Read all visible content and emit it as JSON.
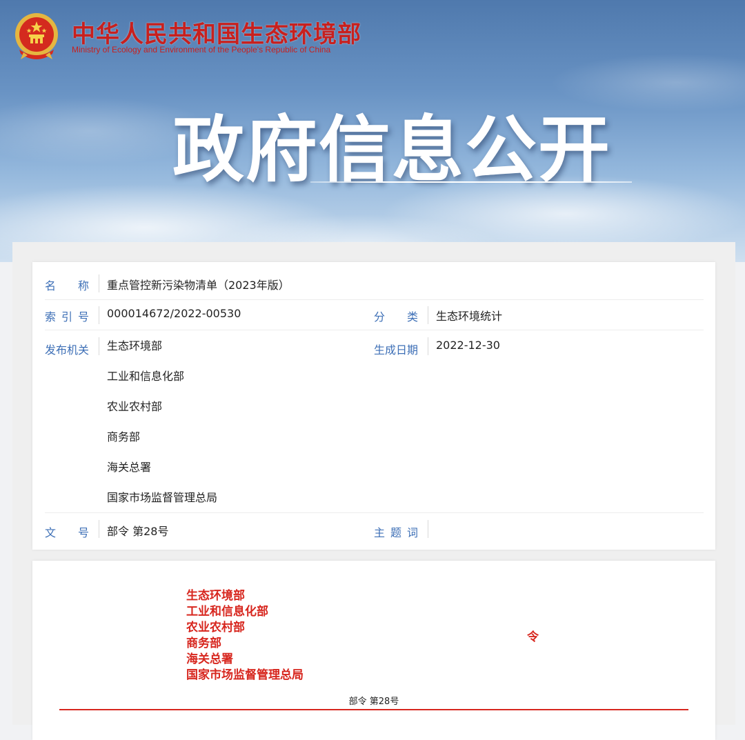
{
  "header": {
    "ministry_cn": "中华人民共和国生态环境部",
    "ministry_en": "Ministry of Ecology and Environment of the People's Republic of China",
    "banner_title": "政府信息公开",
    "emblem_icon": "national-emblem-icon"
  },
  "info": {
    "name_label": "名　　称",
    "name_value": "重点管控新污染物清单（2023年版）",
    "index_label": "索 引 号",
    "index_value": "000014672/2022-00530",
    "category_label": "分　　类",
    "category_value": "生态环境统计",
    "publisher_label": "发布机关",
    "publishers": [
      "生态环境部",
      "工业和信息化部",
      "农业农村部",
      "商务部",
      "海关总署",
      "国家市场监督管理总局"
    ],
    "date_label": "生成日期",
    "date_value": "2022-12-30",
    "doc_no_label": "文　　号",
    "doc_no_value": "部令 第28号",
    "keywords_label": "主 题 词",
    "keywords_value": ""
  },
  "document": {
    "issuers": [
      "生态环境部",
      "工业和信息化部",
      "农业农村部",
      "商务部",
      "海关总署",
      "国家市场监督管理总局"
    ],
    "order_char": "令",
    "order_number": "部令 第28号"
  },
  "colors": {
    "brand_red": "#c8201e",
    "label_blue": "#3d6fb6",
    "doc_red": "#d7261e"
  }
}
